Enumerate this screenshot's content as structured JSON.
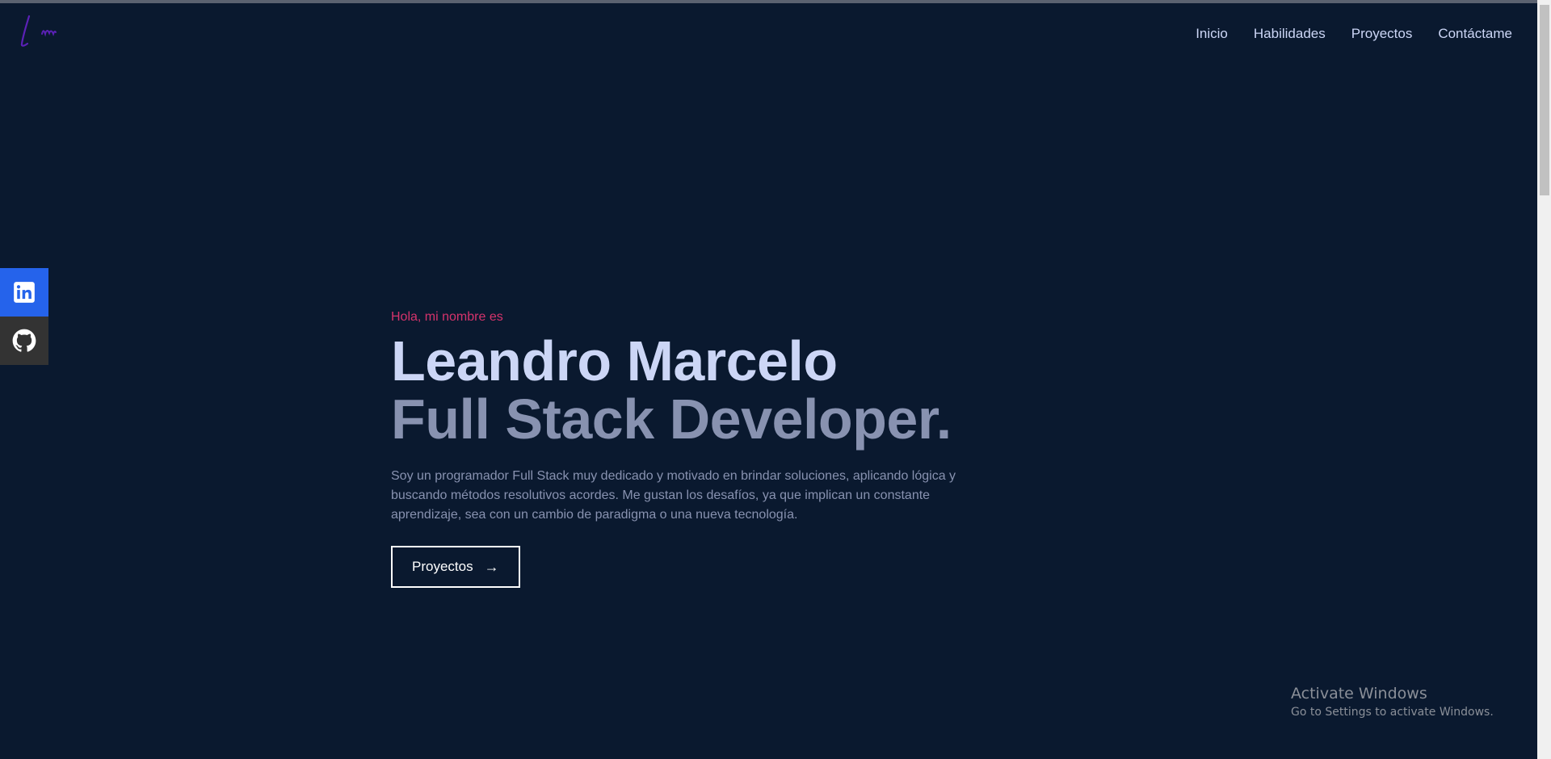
{
  "logo": {
    "text": "Lm",
    "color": "#5b21b6"
  },
  "nav": {
    "items": [
      {
        "label": "Inicio"
      },
      {
        "label": "Habilidades"
      },
      {
        "label": "Proyectos"
      },
      {
        "label": "Contáctame"
      }
    ]
  },
  "social": {
    "linkedin_icon": "linkedin-icon",
    "github_icon": "github-icon",
    "linkedin_color": "#2563eb",
    "github_color": "#333333"
  },
  "hero": {
    "greeting": "Hola, mi nombre es",
    "name": "Leandro Marcelo",
    "role": "Full Stack Developer.",
    "bio": "Soy un programador Full Stack muy dedicado y motivado en brindar soluciones, aplicando lógica y buscando métodos resolutivos acordes. Me gustan los desafíos, ya que implican un constante aprendizaje, sea con un cambio de paradigma o una nueva tecnología.",
    "cta_label": "Proyectos",
    "cta_arrow": "→"
  },
  "watermark": {
    "title": "Activate Windows",
    "subtitle": "Go to Settings to activate Windows."
  },
  "colors": {
    "background": "#0a192f",
    "greeting": "#d6336c",
    "name": "#ccd6f6",
    "role": "#8892b0"
  }
}
